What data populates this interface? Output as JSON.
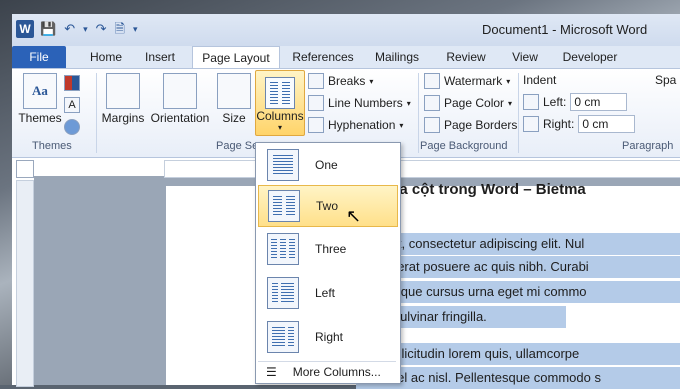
{
  "titlebar": {
    "app_icon": "W",
    "title": "Document1 - Microsoft Word"
  },
  "tabs": [
    "File",
    "Home",
    "Insert",
    "Page Layout",
    "References",
    "Mailings",
    "Review",
    "View",
    "Developer"
  ],
  "ribbon": {
    "themes": {
      "label": "Themes",
      "group": "Themes"
    },
    "page_setup": {
      "margins": "Margins",
      "orientation": "Orientation",
      "size": "Size",
      "columns": "Columns",
      "breaks": "Breaks",
      "line_numbers": "Line Numbers",
      "hyphenation": "Hyphenation",
      "group": "Page Se"
    },
    "page_background": {
      "watermark": "Watermark",
      "page_color": "Page Color",
      "page_borders": "Page Borders",
      "group": "Page Background"
    },
    "paragraph": {
      "indent": "Indent",
      "left_label": "Left:",
      "left_value": "0 cm",
      "right_label": "Right:",
      "right_value": "0 cm",
      "spacing": "Spa",
      "group": "Paragraph"
    }
  },
  "columns_menu": {
    "items": [
      "One",
      "Two",
      "Three",
      "Left",
      "Right"
    ],
    "hovered": "Two",
    "more": "More Columns..."
  },
  "document": {
    "heading": "ch chia cột trong Word – Bietma",
    "lines": [
      "sit amet, consectetur adipiscing elit. Nul",
      "cu placerat posuere ac quis nibh. Curabi",
      "ellentesque cursus urna eget mi commo",
      "aculis pulvinar fringilla.",
      "tum, sollicitudin lorem quis, ullamcorpe",
      "s bus vel ac nisl. Pellentesque commodo s"
    ]
  }
}
